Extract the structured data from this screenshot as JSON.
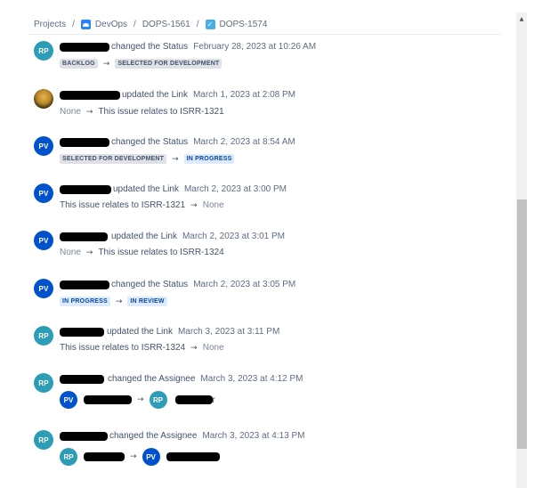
{
  "breadcrumb": {
    "projects": "Projects",
    "sep": "/",
    "project": "DevOps",
    "issue_parent": "DOPS-1561",
    "issue_current": "DOPS-1574"
  },
  "history": [
    {
      "avatar": "RP",
      "action": "changed the Status",
      "time": "February 28, 2023 at 10:26 AM",
      "from": "BACKLOG",
      "to": "SELECTED FOR DEVELOPMENT"
    },
    {
      "avatar": "",
      "action": "updated the Link",
      "time": "March 1, 2023 at 2:08 PM",
      "from": "None",
      "to": "This issue relates to ISRR-1321"
    },
    {
      "avatar": "PV",
      "action": "changed the Status",
      "time": "March 2, 2023 at 8:54 AM",
      "from": "SELECTED FOR DEVELOPMENT",
      "to": "IN PROGRESS"
    },
    {
      "avatar": "PV",
      "action": "updated the Link",
      "time": "March 2, 2023 at 3:00 PM",
      "from": "This issue relates to ISRR-1321",
      "to": "None"
    },
    {
      "avatar": "PV",
      "action": "updated the Link",
      "time": "March 2, 2023 at 3:01 PM",
      "from": "None",
      "to": "This issue relates to ISRR-1324"
    },
    {
      "avatar": "PV",
      "action": "changed the Status",
      "time": "March 2, 2023 at 3:05 PM",
      "from": "IN PROGRESS",
      "to": "IN REVIEW"
    },
    {
      "avatar": "RP",
      "action": "updated the Link",
      "time": "March 3, 2023 at 3:11 PM",
      "from": "This issue relates to ISRR-1324",
      "to": "None"
    },
    {
      "avatar": "RP",
      "action": "changed the Assignee",
      "time": "March 3, 2023 at 4:12 PM",
      "from_avatar": "PV",
      "to_avatar": "RP",
      "to_suffix": "r"
    },
    {
      "avatar": "RP",
      "action": "changed the Assignee",
      "time": "March 3, 2023 at 4:13 PM",
      "from_avatar": "RP",
      "to_avatar": "PV"
    }
  ],
  "arrow": "→",
  "icons": {
    "project": "devops-project-icon",
    "issue": "task-checkbox-icon"
  },
  "colors": {
    "rp": "#2d9cb6",
    "pv": "#0052cc",
    "lozenge_grey": "#dfe1e6",
    "lozenge_blue": "#deebff"
  }
}
